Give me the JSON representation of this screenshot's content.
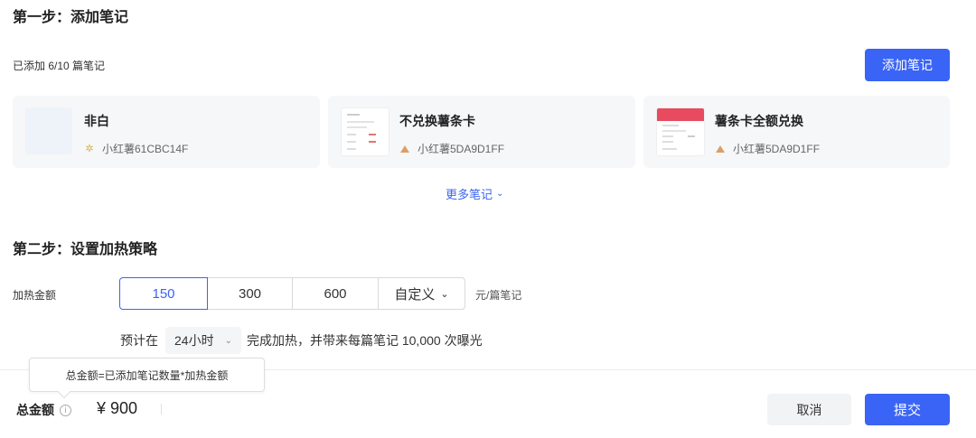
{
  "step1": {
    "title": "第一步：添加笔记",
    "added_count": "已添加 6/10 篇笔记",
    "add_button": "添加笔记",
    "notes": [
      {
        "title": "非白",
        "author": "小红薯61CBC14F",
        "author_icon": "sun-icon"
      },
      {
        "title": "不兑换薯条卡",
        "author": "小红薯5DA9D1FF",
        "author_icon": "triangle-avatar-icon"
      },
      {
        "title": "薯条卡全额兑换",
        "author": "小红薯5DA9D1FF",
        "author_icon": "triangle-avatar-icon"
      }
    ],
    "more_notes": "更多笔记"
  },
  "step2": {
    "title": "第二步：设置加热策略",
    "amount_label": "加热金额",
    "amount_options": [
      "150",
      "300",
      "600",
      "自定义"
    ],
    "selected_amount": "150",
    "unit": "元/篇笔记",
    "estimate_prefix": "预计在",
    "duration": "24小时",
    "estimate_suffix": "完成加热，并带来每篇笔记 10,000 次曝光"
  },
  "footer": {
    "tooltip": "总金额=已添加笔记数量*加热金额",
    "total_label": "总金额",
    "total_value": "¥ 900",
    "cancel": "取消",
    "submit": "提交"
  },
  "colors": {
    "accent": "#3a64f5",
    "card_bg": "#f6f7f9"
  }
}
